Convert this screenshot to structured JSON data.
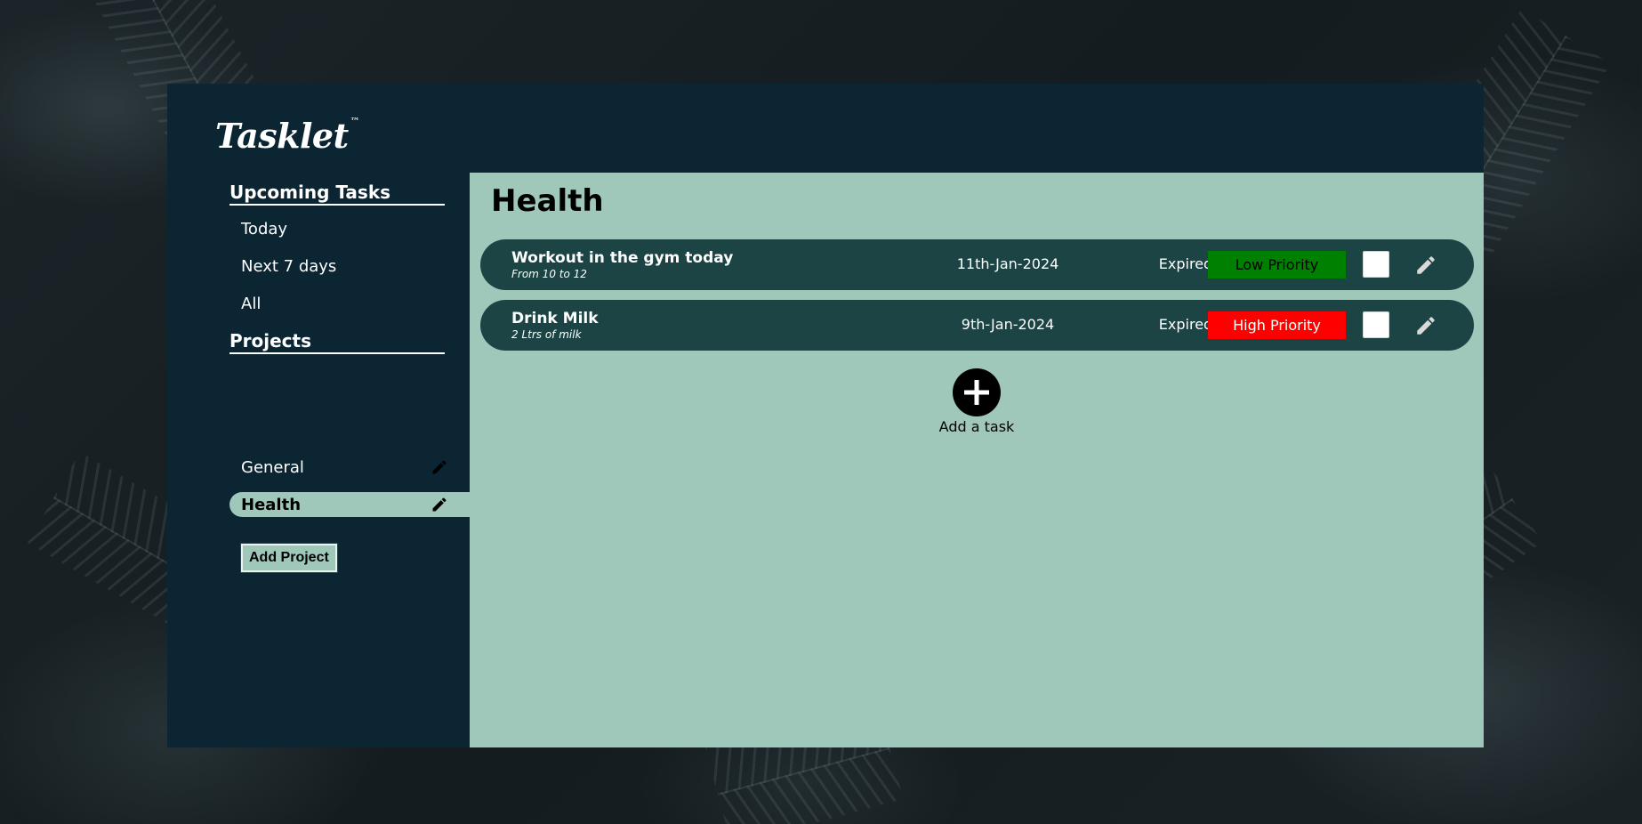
{
  "app": {
    "brand": "Tasklet",
    "trademark": "™"
  },
  "sidebar": {
    "upcoming_title": "Upcoming Tasks",
    "upcoming_items": [
      {
        "label": "Today"
      },
      {
        "label": "Next 7 days"
      },
      {
        "label": "All"
      }
    ],
    "projects_title": "Projects",
    "projects": [
      {
        "label": "General",
        "active": false
      },
      {
        "label": "Health",
        "active": true
      }
    ],
    "add_project_label": "Add Project"
  },
  "main": {
    "title": "Health",
    "tasks": [
      {
        "title": "Workout in the gym today",
        "description": "From 10 to 12",
        "date": "11th-Jan-2024",
        "status": "Expired",
        "priority": "Low Priority",
        "priority_color": "#008000",
        "priority_text_color": "#000000",
        "done": false
      },
      {
        "title": "Drink Milk",
        "description": "2 Ltrs of milk",
        "date": "9th-Jan-2024",
        "status": "Expired",
        "priority": "High Priority",
        "priority_color": "#ff0000",
        "priority_text_color": "#ffffff",
        "done": false
      }
    ],
    "add_task_label": "Add a task"
  },
  "colors": {
    "app_bg": "#0b2533",
    "content_bg": "#9fc8ba",
    "task_row_bg": "#1c4444"
  },
  "icons": {
    "edit": "pencil-icon",
    "add": "plus-circle-icon"
  }
}
